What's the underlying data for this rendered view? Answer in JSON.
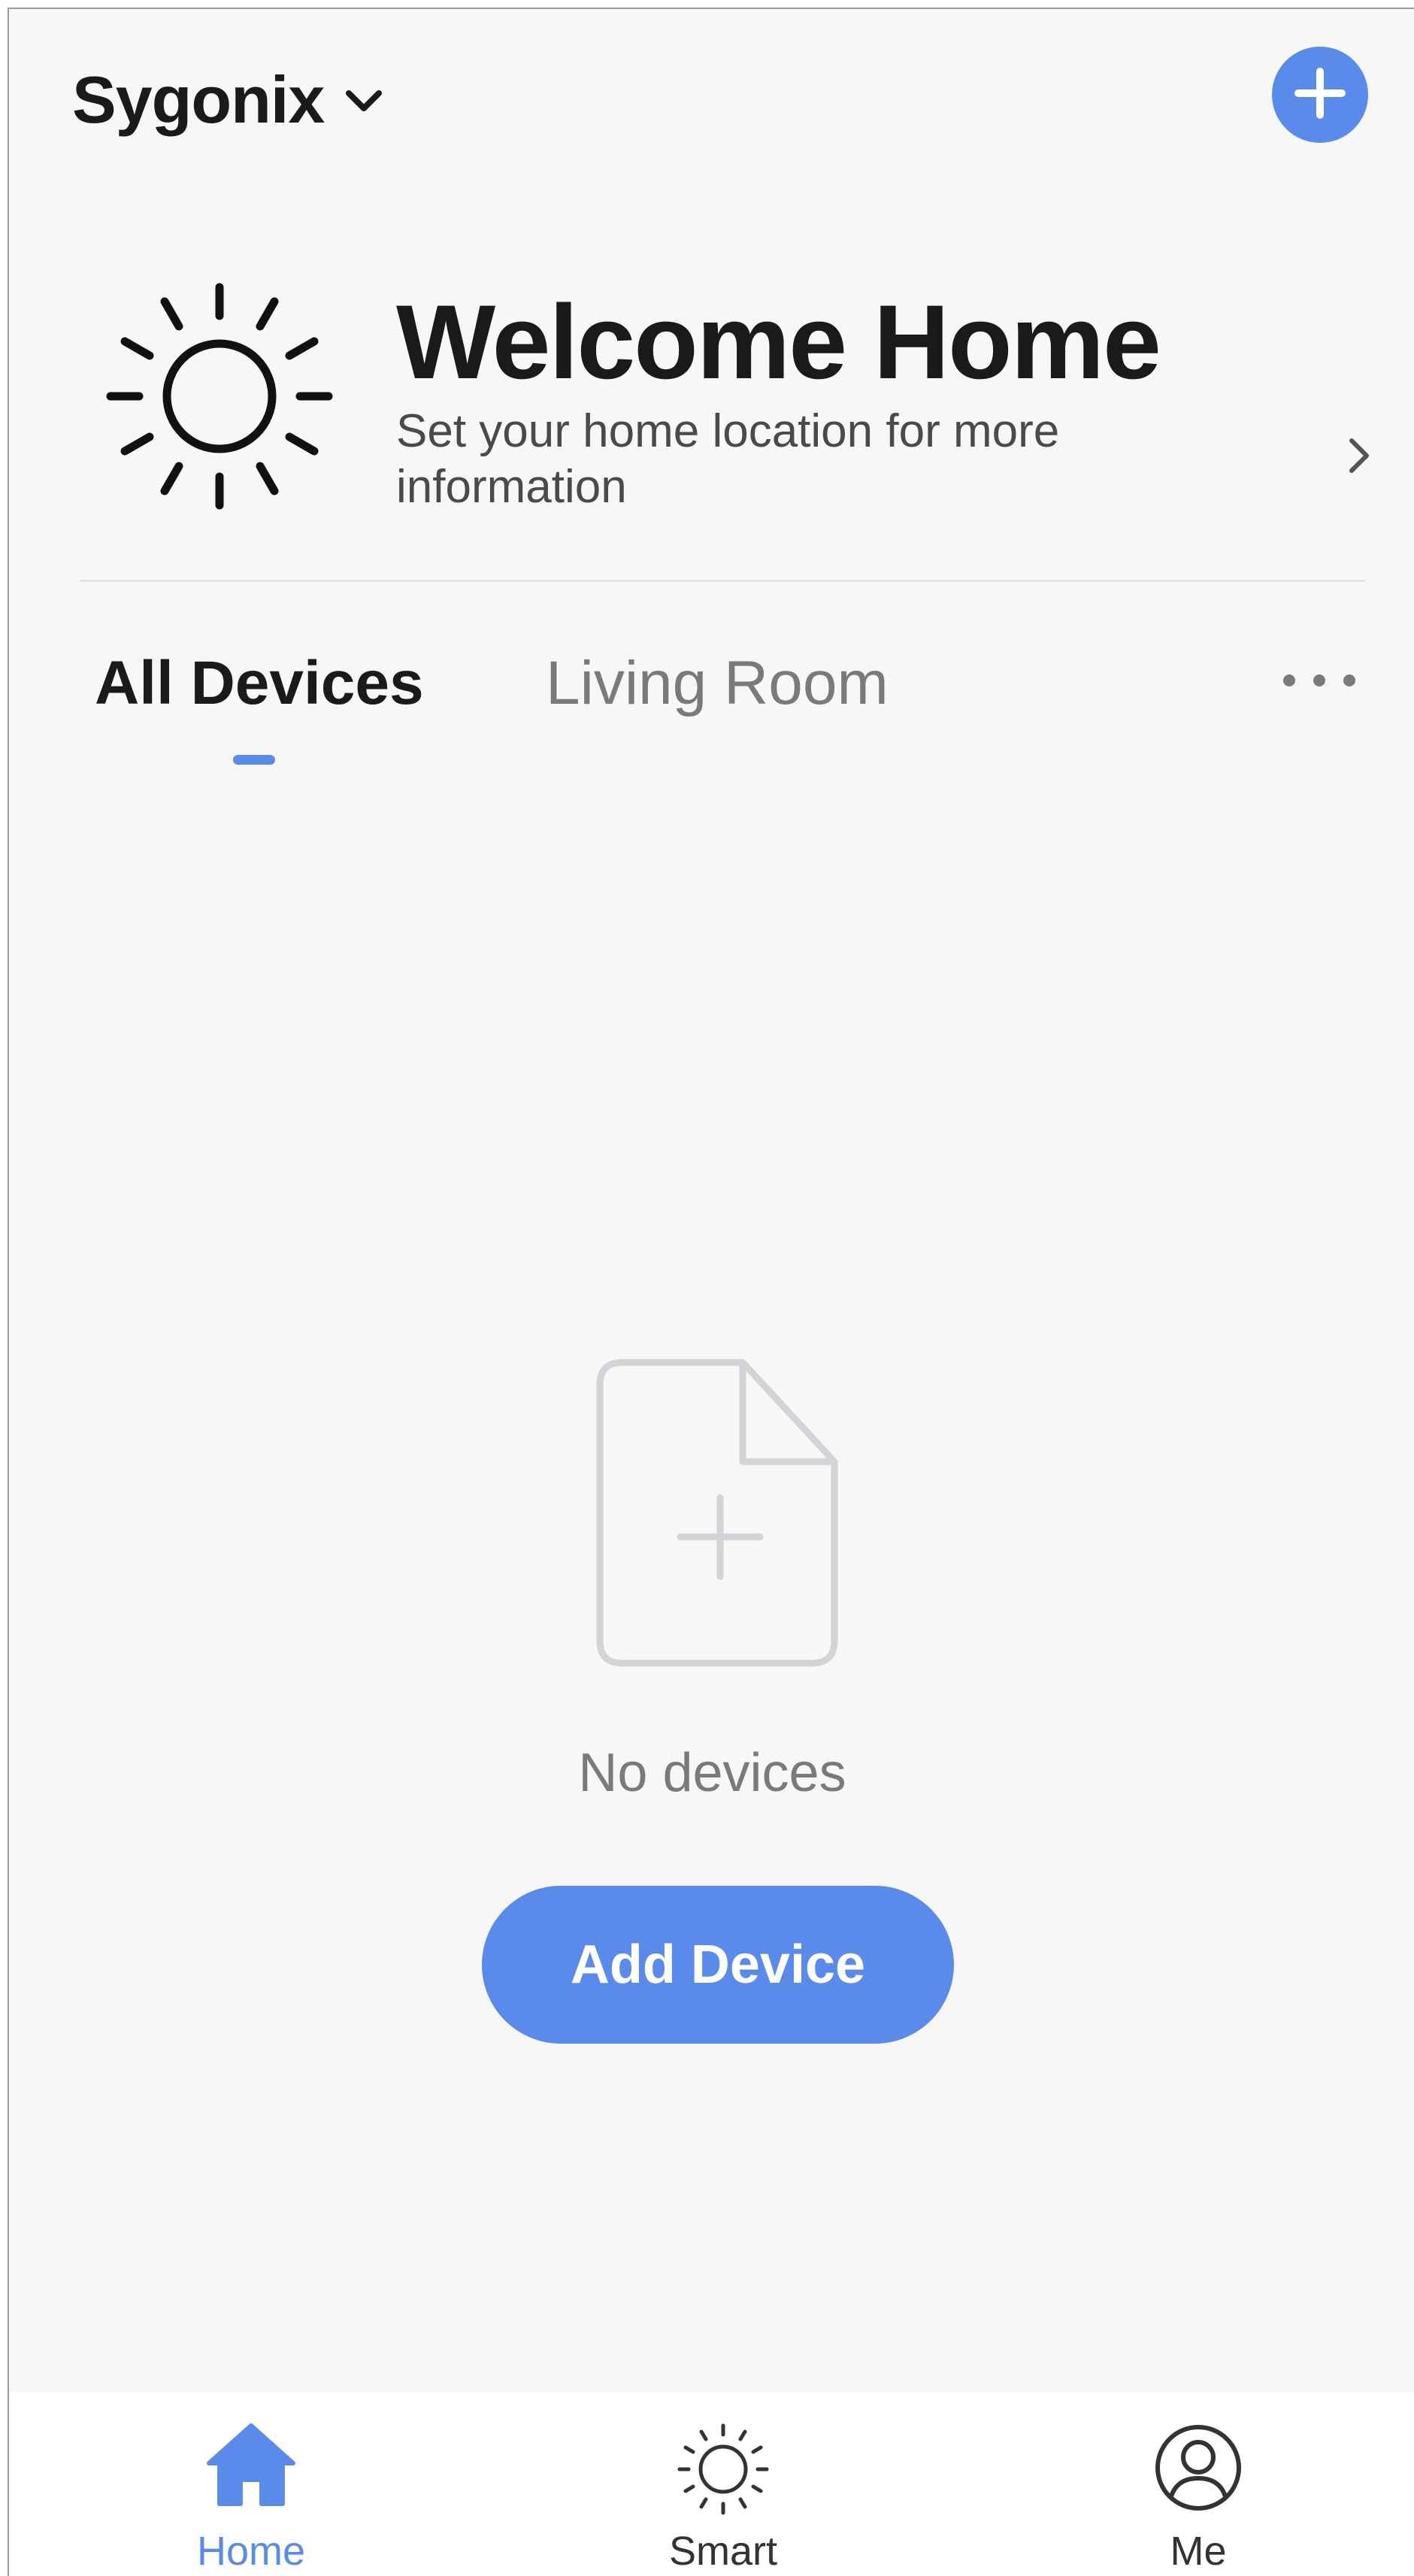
{
  "header": {
    "home_name": "Sygonix",
    "dropdown_icon": "chevron-down-icon",
    "add_icon": "plus-icon",
    "accent_color": "#5a8bea"
  },
  "weather_card": {
    "icon": "sun-icon",
    "title": "Welcome Home",
    "subtitle": "Set your home location for more information",
    "chevron_icon": "chevron-right-icon"
  },
  "tabs": {
    "items": [
      {
        "label": "All Devices",
        "active": true
      },
      {
        "label": "Living Room",
        "active": false
      }
    ],
    "more_icon": "more-horizontal-icon"
  },
  "empty_state": {
    "icon": "add-document-icon",
    "message": "No devices",
    "button_label": "Add Device"
  },
  "bottom_nav": {
    "items": [
      {
        "label": "Home",
        "icon": "home-icon",
        "active": true
      },
      {
        "label": "Smart",
        "icon": "sun-icon",
        "active": false
      },
      {
        "label": "Me",
        "icon": "user-circle-icon",
        "active": false
      }
    ]
  }
}
